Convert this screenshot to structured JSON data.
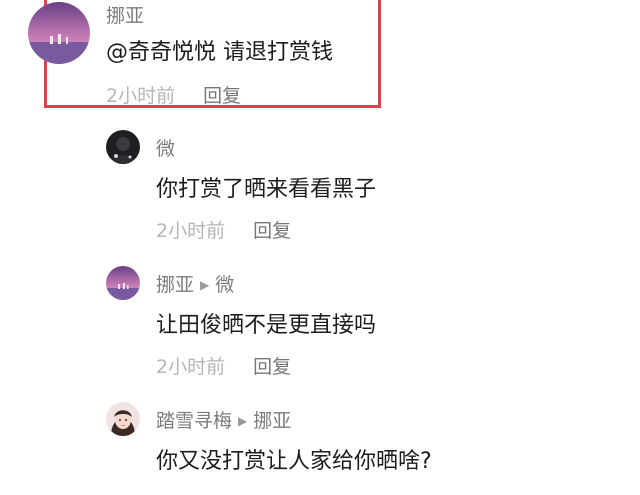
{
  "comments": [
    {
      "author": "挪亚",
      "reply_to": "",
      "text": "@奇奇悦悦 请退打赏钱",
      "time": "2小时前",
      "reply_label": "回复",
      "avatar_icon": "sunset-sea-avatar-icon"
    },
    {
      "author": "微",
      "reply_to": "",
      "text": "你打赏了晒来看看黑子",
      "time": "2小时前",
      "reply_label": "回复",
      "avatar_icon": "dark-portrait-avatar-icon"
    },
    {
      "author": "挪亚",
      "reply_to": "微",
      "text": "让田俊晒不是更直接吗",
      "time": "2小时前",
      "reply_label": "回复",
      "avatar_icon": "sunset-sea-avatar-icon"
    },
    {
      "author": "踏雪寻梅",
      "reply_to": "挪亚",
      "text": "你又没打赏让人家给你晒啥?",
      "time": "",
      "reply_label": "",
      "avatar_icon": "girl-portrait-avatar-icon"
    }
  ],
  "colors": {
    "highlight_border": "#d9434f",
    "name": "#7c7c7c",
    "time": "#b5b5b5"
  }
}
